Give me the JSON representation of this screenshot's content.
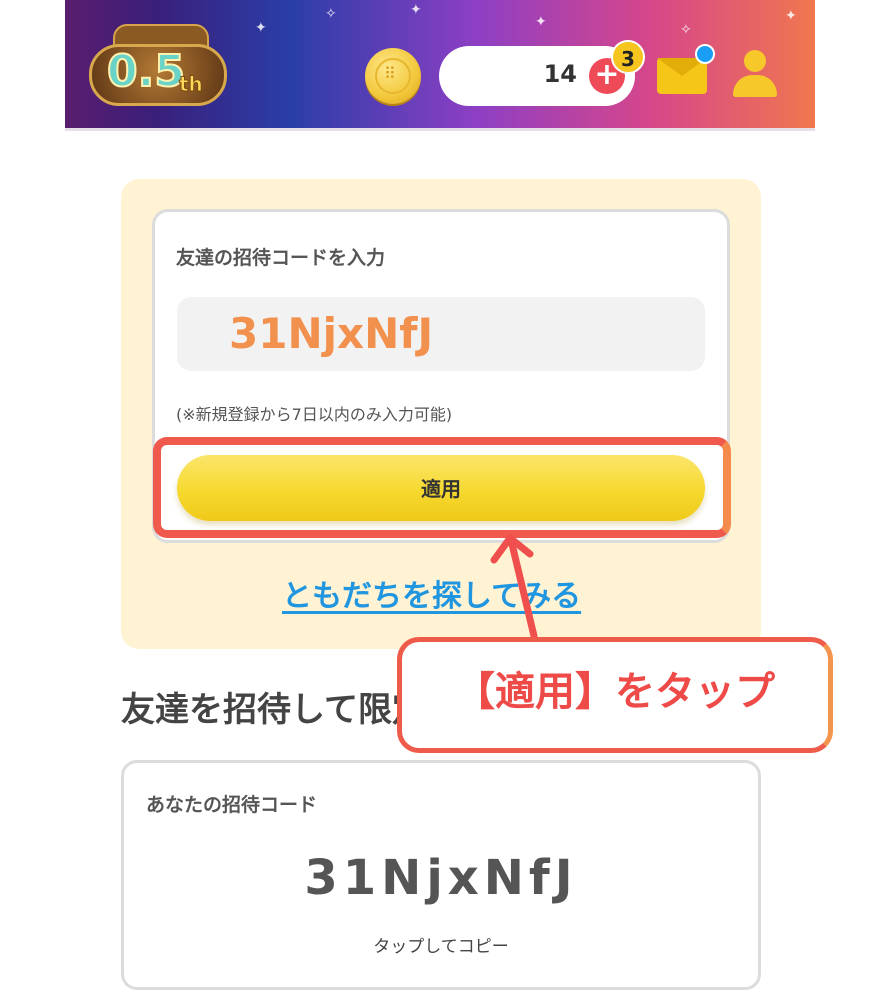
{
  "header": {
    "logo_text": "0.5",
    "logo_suffix": "th",
    "ticket_count": "14",
    "plus_label": "+",
    "notification_badge": "3",
    "icons": [
      "coin-icon",
      "plus-icon",
      "mail-icon",
      "user-icon"
    ]
  },
  "invite": {
    "title": "友達の招待コードを入力",
    "input_value": "31NjxNfJ",
    "note": "(※新規登録から7日以内のみ入力可能)",
    "apply_label": "適用",
    "find_friends_link": "ともだちを探してみる"
  },
  "section": {
    "title": "友達を招待して限定"
  },
  "my_code": {
    "title": "あなたの招待コード",
    "code": "31NjxNfJ",
    "tap_hint": "タップしてコピー"
  },
  "annotation": {
    "callout_text": "【適用】をタップ"
  },
  "colors": {
    "accent_yellow": "#f6d92f",
    "panel_bg": "#fff3d3",
    "input_code": "#f2904e",
    "link_blue": "#2196e0",
    "highlight_red": "#f05a4c",
    "badge_red": "#ef4a58"
  }
}
